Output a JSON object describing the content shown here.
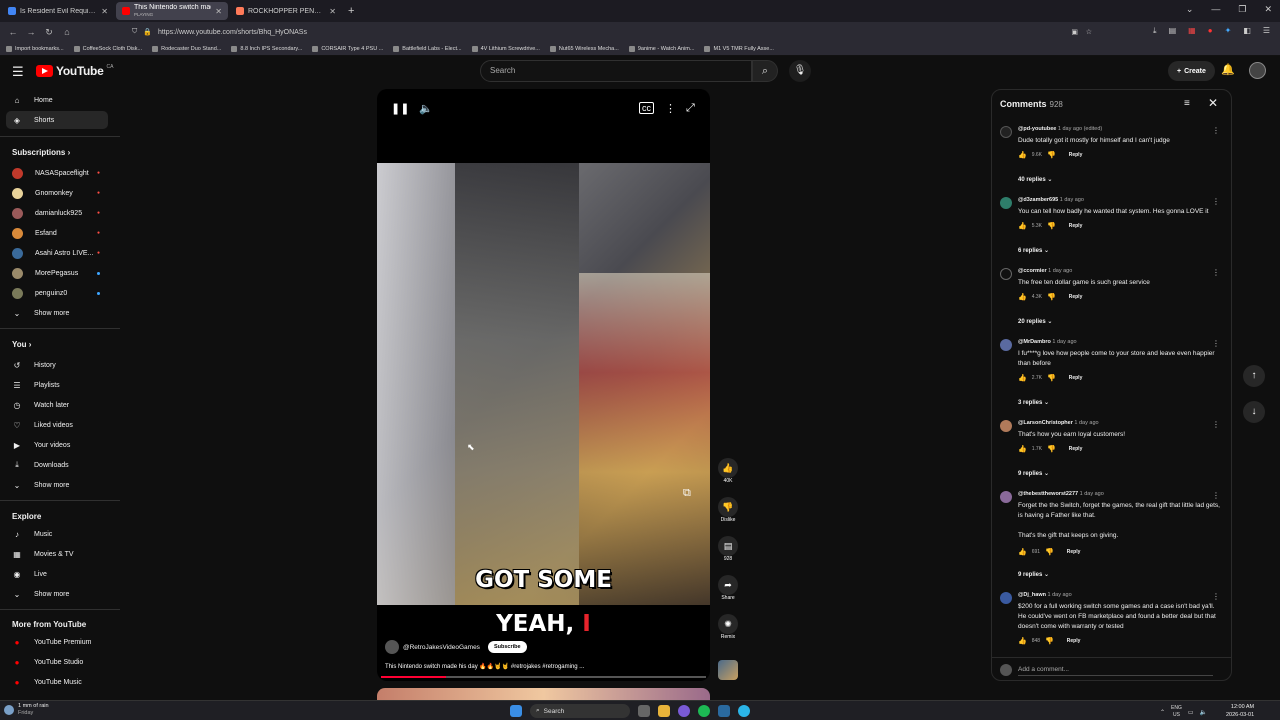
{
  "browser": {
    "tabs": [
      {
        "title": "Is Resident Evil Requiem Good",
        "fav_color": "#4285f4"
      },
      {
        "title": "This Nintendo switch made his",
        "sub": "PLAYING",
        "fav_color": "#ff0000"
      },
      {
        "title": "ROCKHOPPER PENGUIN at Duo",
        "fav_color": "#ff7a59"
      }
    ],
    "url": "https://www.youtube.com/shorts/Bhq_HyONASs",
    "bookmarks": [
      "Import bookmarks...",
      "CoffeeSock Cloth Disk...",
      "Rodecaster Duo Stand...",
      "8.8 Inch IPS Secondary...",
      "CORSAIR Type 4 PSU ...",
      "Battlefield Labs - Elect...",
      "4V Lithium Screwdrive...",
      "Nut65 Wireless Mecha...",
      "9anime - Watch Anim...",
      "M1 V5 TMR Fully Asse..."
    ]
  },
  "header": {
    "logo_text": "YouTube",
    "country": "CA",
    "search_placeholder": "Search",
    "create_label": "Create"
  },
  "sidebar": {
    "main": [
      {
        "label": "Home",
        "icon": "home-icon",
        "glyph": "⌂"
      },
      {
        "label": "Shorts",
        "icon": "shorts-icon",
        "glyph": "◈"
      }
    ],
    "subscriptions_title": "Subscriptions",
    "subscriptions": [
      {
        "label": "NASASpaceflight",
        "color": "#c0392b",
        "badge": "red"
      },
      {
        "label": "Gnomonkey",
        "color": "#e8d29a",
        "badge": "red"
      },
      {
        "label": "damianluck925",
        "color": "#9a5a5a",
        "badge": "red"
      },
      {
        "label": "Esfand",
        "color": "#d98a3a",
        "badge": "red"
      },
      {
        "label": "Asahi Astro LIVE...",
        "color": "#3a6a9a",
        "badge": "red"
      },
      {
        "label": "MorePegasus",
        "color": "#9a8a6a",
        "badge": "dot"
      },
      {
        "label": "penguinz0",
        "color": "#7a7a5a",
        "badge": "dot"
      }
    ],
    "show_more": "Show more",
    "you_title": "You",
    "you_items": [
      {
        "label": "History",
        "glyph": "↺"
      },
      {
        "label": "Playlists",
        "glyph": "☰"
      },
      {
        "label": "Watch later",
        "glyph": "◷"
      },
      {
        "label": "Liked videos",
        "glyph": "👍"
      },
      {
        "label": "Your videos",
        "glyph": "▶"
      },
      {
        "label": "Downloads",
        "glyph": "⤓"
      }
    ],
    "explore_title": "Explore",
    "explore_items": [
      {
        "label": "Music",
        "glyph": "♪"
      },
      {
        "label": "Movies & TV",
        "glyph": "▦"
      },
      {
        "label": "Live",
        "glyph": "◉"
      }
    ],
    "more_title": "More from YouTube",
    "more_items": [
      {
        "label": "YouTube Premium",
        "color": "#ff0000"
      },
      {
        "label": "YouTube Studio",
        "color": "#ff0000"
      },
      {
        "label": "YouTube Music",
        "color": "#ff0000"
      }
    ]
  },
  "short": {
    "caption_line1": "YEAH,",
    "caption_highlight": "I",
    "caption_line2": "GOT SOME",
    "channel": "@RetroJakesVideoGames",
    "subscribe_label": "Subscribe",
    "title": "This Nintendo switch made his day 🔥🔥🤘🤘 #retrojakes #retrogaming ...",
    "progress": 0.2
  },
  "actions": {
    "like_count": "40K",
    "dislike_label": "Dislike",
    "comment_count": "928",
    "share_label": "Share",
    "remix_label": "Remix"
  },
  "comments": {
    "title": "Comments",
    "count": "928",
    "add_placeholder": "Add a comment...",
    "reply_label": "Reply",
    "items": [
      {
        "user": "@pd-youtubee",
        "time": "1 day ago (edited)",
        "text": "Dude totally got it mostly for himself and I can't judge",
        "likes": "9.6K",
        "replies": "40 replies",
        "color": "#222"
      },
      {
        "user": "@d3zamber695",
        "time": "1 day ago",
        "text": "You can tell how badly he wanted that system. Hes gonna LOVE it",
        "likes": "5.3K",
        "replies": "6 replies",
        "color": "#2e7d6a"
      },
      {
        "user": "@ccormier",
        "time": "1 day ago",
        "text": "The free ten dollar game is such great service",
        "likes": "4.3K",
        "replies": "20 replies",
        "color": "#111"
      },
      {
        "user": "@MrDambro",
        "time": "1 day ago",
        "text": "I fu****g love how people come to your store and leave even happier than before",
        "likes": "2.7K",
        "replies": "3 replies",
        "color": "#5a6aa0"
      },
      {
        "user": "@LarsonChristopher",
        "time": "1 day ago",
        "text": "That's how you earn loyal customers!",
        "likes": "1.7K",
        "replies": "9 replies",
        "color": "#b07a5a"
      },
      {
        "user": "@thebesttheworst2277",
        "time": "1 day ago",
        "text": "Forget the the Switch, forget the games, the real gift that little lad gets, is having a Father like that.",
        "text2": "That's the gift that keeps on giving.",
        "likes": "691",
        "replies": "9 replies",
        "color": "#8a6a9a"
      },
      {
        "user": "@Dj_hawn",
        "time": "1 day ago",
        "text": "$200 for a full working switch some games and a case isn't bad ya'll. He could've went on FB marketplace and found a better deal but that doesn't come with warranty or tested",
        "likes": "848",
        "color": "#3a5aa0"
      }
    ]
  },
  "taskbar": {
    "weather": "1 mm of rain",
    "weather_day": "Friday",
    "search_label": "Search",
    "lang": "ENG",
    "region": "US",
    "time": "12:00 AM",
    "date": "2026-03-01"
  }
}
